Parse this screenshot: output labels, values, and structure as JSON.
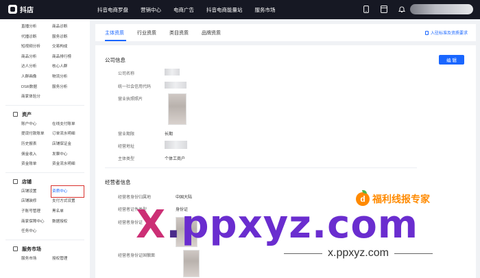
{
  "app": {
    "name": "抖店"
  },
  "nav": [
    "抖音电商罗盘",
    "营销中心",
    "电商广告",
    "抖音电商能量站",
    "服务市场"
  ],
  "topicons": [
    "phone-icon",
    "grid-icon",
    "bell-icon"
  ],
  "sidebar": {
    "top_items": [
      [
        "直播分析",
        "商品诊断"
      ],
      [
        "代播诊断",
        "服务诊断"
      ],
      [
        "短视频分析",
        "交易构成"
      ],
      [
        "商品分析",
        "商品排行榜"
      ],
      [
        "达人分析",
        "核心人群"
      ],
      [
        "人群画像",
        "物流分析"
      ],
      [
        "DSR数据",
        "服务分析"
      ],
      [
        "商家体验分",
        ""
      ]
    ],
    "sections": [
      {
        "title": "资产",
        "items": [
          [
            "账户中心",
            "在线支付账单"
          ],
          [
            "提现付款账单",
            "订单流水明细"
          ],
          [
            "历史报表",
            "店铺保证金"
          ],
          [
            "佣金收入",
            "发票中心"
          ],
          [
            "资金账单",
            "资金流水明细"
          ]
        ]
      },
      {
        "title": "店铺",
        "items": [
          [
            "店铺设置",
            "资质中心"
          ],
          [
            "店铺装修",
            "支付方式设置"
          ],
          [
            "子账号管理",
            "黑名单"
          ],
          [
            "商家保障中心",
            "数据授权"
          ],
          [
            "任务中心",
            ""
          ]
        ]
      },
      {
        "title": "服务市场",
        "items": [
          [
            "服务市场",
            "授权管理"
          ]
        ]
      }
    ]
  },
  "tabs": {
    "items": [
      "主体资质",
      "行业资质",
      "类目资质",
      "品牌资质"
    ],
    "active": 0,
    "link": "入驻标准及资质要求"
  },
  "company": {
    "title": "公司信息",
    "edit_label": "编 辑",
    "labels": [
      "公司名称",
      "统一社会信用代码",
      "营业执照照片",
      "营业期限",
      "经营地址",
      "主体类型"
    ],
    "term_value": "长期",
    "type_value": "个体工商户"
  },
  "operator": {
    "title": "经营者信息",
    "labels": [
      "经营者身份归属地",
      "经营者证件类型",
      "经营者身份证",
      "",
      "经营者身份证国徽面"
    ],
    "region_value": "中国大陆",
    "id_type_value": "身份证"
  },
  "watermark": {
    "big_x": "X",
    "big_dot": ".",
    "big_rest": "ppxyz.com",
    "badge": "福利线报专家",
    "url": "x.ppxyz.com"
  }
}
